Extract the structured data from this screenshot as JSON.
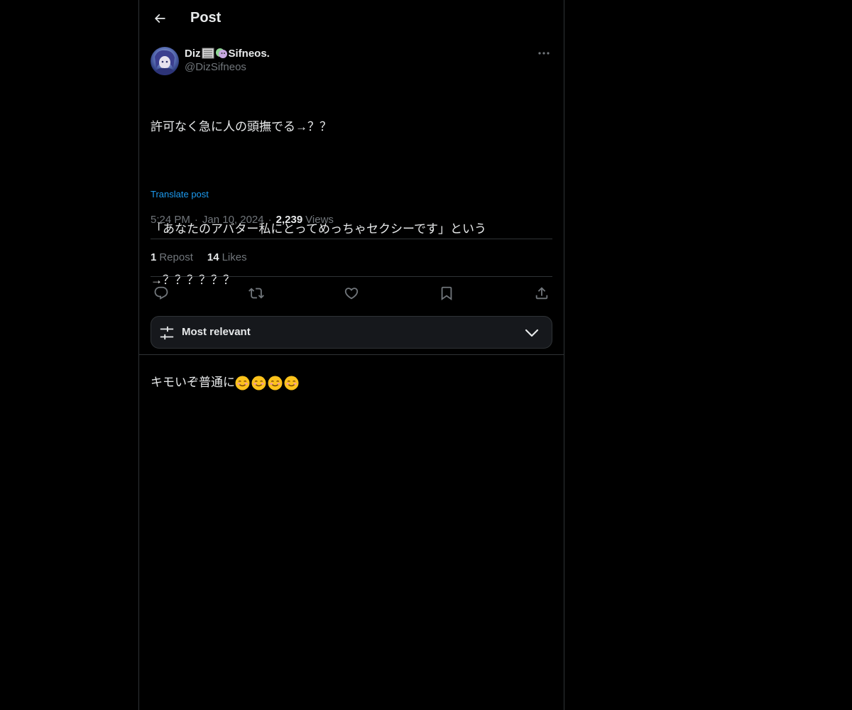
{
  "header": {
    "title": "Post"
  },
  "post": {
    "author": {
      "display_name_prefix": "Diz",
      "display_name_suffix": "Sifneos.",
      "handle": "@DizSifneos"
    },
    "body_lines": {
      "line1": "許可なく急に人の頭撫でる→？？",
      "line2": "「あなたのアバター私にとってめっちゃセクシーです」という",
      "line3": "→？？？？？？",
      "line4": "キモいぞ普通に"
    },
    "translate_label": "Translate post",
    "time": "5:24 PM",
    "date": "Jan 10, 2024",
    "views_count": "2,239",
    "views_label": "Views",
    "reposts_count": "1",
    "reposts_label": "Repost",
    "likes_count": "14",
    "likes_label": "Likes"
  },
  "sort": {
    "label": "Most relevant"
  },
  "colors": {
    "background": "#000000",
    "border": "#2f3336",
    "text_primary": "#e7e9ea",
    "text_secondary": "#71767b",
    "link": "#1d9bf0"
  }
}
